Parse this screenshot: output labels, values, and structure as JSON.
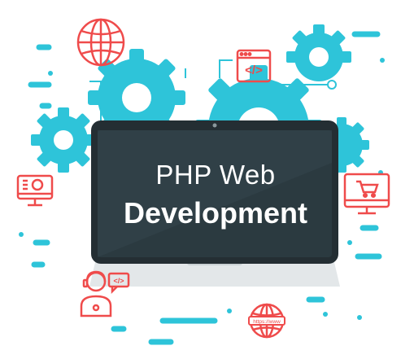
{
  "headline": {
    "line1": "PHP Web",
    "line2": "Development"
  },
  "icons": [
    {
      "name": "globe-icon"
    },
    {
      "name": "code-window-icon"
    },
    {
      "name": "monitor-icon"
    },
    {
      "name": "shopping-cart-monitor-icon"
    },
    {
      "name": "developer-icon"
    },
    {
      "name": "www-globe-icon"
    }
  ],
  "www_badge": "https://www",
  "code_glyph": "</>",
  "colors": {
    "gear": "#2ec4d9",
    "accent_red": "#ef4b4b",
    "laptop_dark": "#2b3a40",
    "laptop_frame": "#242e33",
    "base": "#e3e7e9"
  }
}
